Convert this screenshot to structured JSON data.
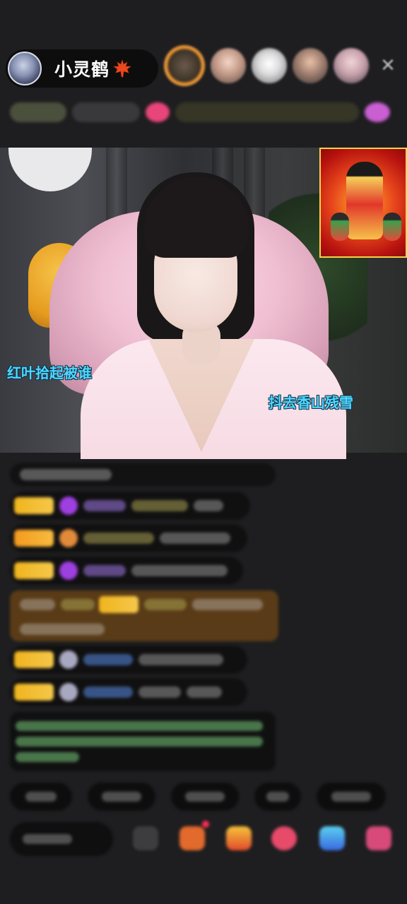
{
  "header": {
    "host_name": "小灵鹤",
    "host_badge_icon": "maple-leaf-icon",
    "viewers": [
      "viewer-avatar-1",
      "viewer-avatar-2",
      "viewer-avatar-3",
      "viewer-avatar-4",
      "viewer-avatar-5"
    ],
    "close_icon": "close-icon"
  },
  "video": {
    "overlay_image": "caishen-sticker",
    "danmu": [
      "红叶拾起被谁",
      "抖去香山残雪"
    ]
  },
  "colors": {
    "danmu": "#4fd8ff",
    "badge_gold": "#f0b41e",
    "background": "#1e1e20"
  }
}
